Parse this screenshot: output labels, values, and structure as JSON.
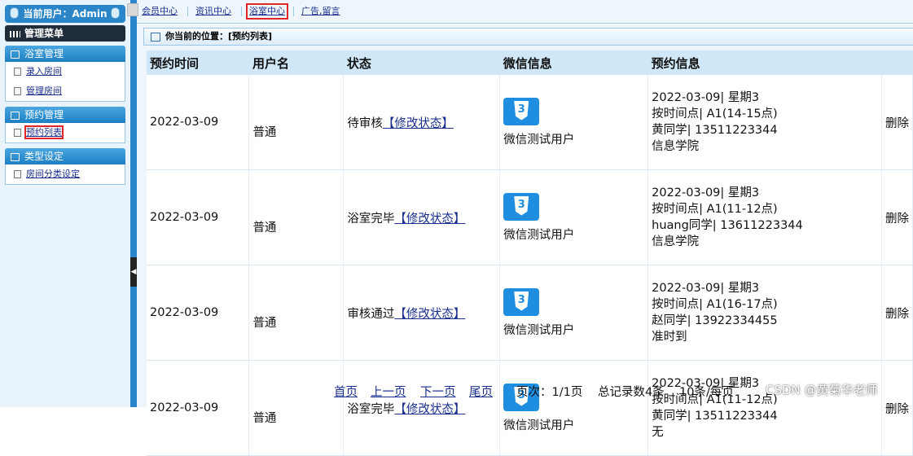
{
  "sidebar": {
    "user_label": "当前用户：Admin",
    "menu_title": "管理菜单",
    "groups": [
      {
        "title": "浴室管理",
        "items": [
          "录入房间",
          "管理房间"
        ]
      },
      {
        "title": "预约管理",
        "items": [
          "预约列表"
        ]
      },
      {
        "title": "类型设定",
        "items": [
          "房间分类设定"
        ]
      }
    ]
  },
  "topnav": {
    "tabs": [
      "会员中心",
      "资讯中心",
      "浴室中心",
      "广告,留言"
    ]
  },
  "breadcrumb": "你当前的位置：[预约列表]",
  "table": {
    "headers": [
      "预约时间",
      "用户名",
      "状态",
      "微信信息",
      "预约信息"
    ],
    "rows": [
      {
        "time": "2022-03-09",
        "user": "普通",
        "status": "待审核",
        "edit": "【修改状态】",
        "wechat": "微信测试用户",
        "info": [
          "2022-03-09| 星期3",
          "按时间点| A1(14-15点)",
          "黄同学| 13511223344",
          "信息学院"
        ],
        "action": "删除"
      },
      {
        "time": "2022-03-09",
        "user": "普通",
        "status": "浴室完毕",
        "edit": "【修改状态】",
        "wechat": "微信测试用户",
        "info": [
          "2022-03-09| 星期3",
          "按时间点| A1(11-12点)",
          "huang同学| 13611223344",
          "信息学院"
        ],
        "action": "删除"
      },
      {
        "time": "2022-03-09",
        "user": "普通",
        "status": "审核通过",
        "edit": "【修改状态】",
        "wechat": "微信测试用户",
        "info": [
          "2022-03-09| 星期3",
          "按时间点| A1(16-17点)",
          "赵同学| 13922334455",
          "准时到"
        ],
        "action": "删除"
      },
      {
        "time": "2022-03-09",
        "user": "普通",
        "status": "浴室完毕",
        "edit": "【修改状态】",
        "wechat": "微信测试用户",
        "info": [
          "2022-03-09| 星期3",
          "按时间点| A1(11-12点)",
          "黄同学| 13511223344",
          "无"
        ],
        "action": "删除"
      }
    ]
  },
  "pager": {
    "first": "首页",
    "prev": "上一页",
    "next": "下一页",
    "last": "尾页",
    "page_info": "页次：1/1页",
    "total": "总记录数4条",
    "per_page": "10条/每页"
  },
  "watermark": "CSDN @黄菊华老师",
  "icons": {
    "wechat_avatar": "css3-icon"
  },
  "colors": {
    "accent": "#2a86c8",
    "highlight": "#e0262b",
    "link": "#1a2f8f"
  }
}
